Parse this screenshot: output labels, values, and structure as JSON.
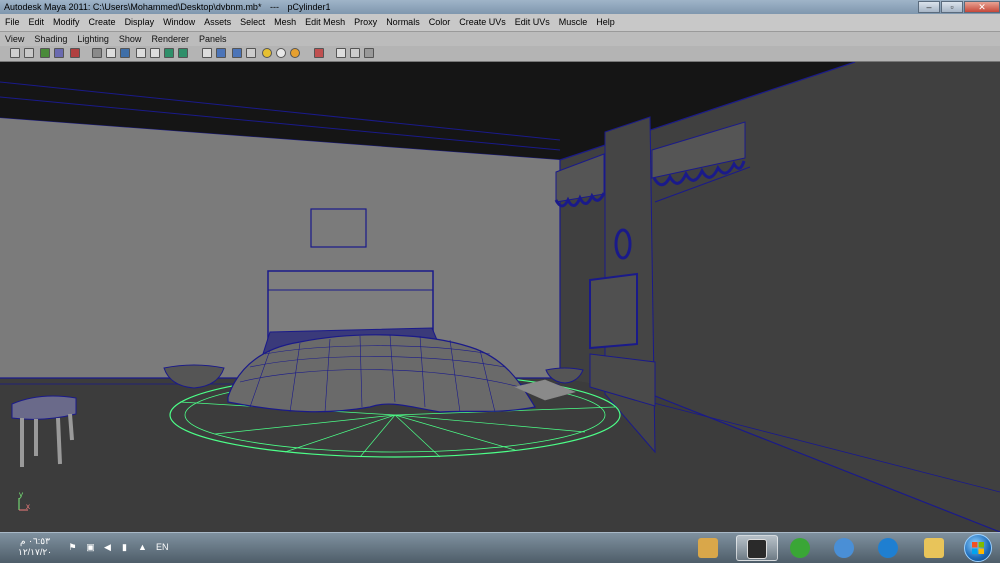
{
  "window": {
    "app_title": "Autodesk Maya 2011: C:\\Users\\Mohammed\\Desktop\\dvbnm.mb*",
    "separator": "---",
    "selected_object": "pCylinder1",
    "controls": [
      "–",
      "▫",
      "✕"
    ]
  },
  "main_menu": [
    "File",
    "Edit",
    "Modify",
    "Create",
    "Display",
    "Window",
    "Assets",
    "Select",
    "Mesh",
    "Edit Mesh",
    "Proxy",
    "Normals",
    "Color",
    "Create UVs",
    "Edit UVs",
    "Muscle",
    "Help"
  ],
  "panel_menu": [
    "View",
    "Shading",
    "Lighting",
    "Show",
    "Renderer",
    "Panels"
  ],
  "viewport": {
    "axis_y": "y",
    "axis_x": "x",
    "colors": {
      "wire": "#1a1a8a",
      "selection": "#4cff88",
      "wall": "#7a7a7a",
      "floor": "#3d3d3d",
      "ceiling": "#141414"
    }
  },
  "taskbar": {
    "time": "٠٦:٥٣ م",
    "date": "١٢/١٧/٢٠",
    "language": "EN",
    "tray_icons": [
      "flag-icon",
      "network-icon",
      "speaker-icon",
      "power-icon"
    ],
    "show_hidden": "▲",
    "apps": [
      {
        "name": "paint-app-icon",
        "color": "#d9a74a"
      },
      {
        "name": "maya-app-icon",
        "color": "#2a2a2a"
      },
      {
        "name": "utorrent-app-icon",
        "color": "#3aa636"
      },
      {
        "name": "messenger-app-icon",
        "color": "#4a8fd6"
      },
      {
        "name": "maxthon-app-icon",
        "color": "#1f7fd1"
      },
      {
        "name": "explorer-app-icon",
        "color": "#e8c45a"
      }
    ]
  }
}
